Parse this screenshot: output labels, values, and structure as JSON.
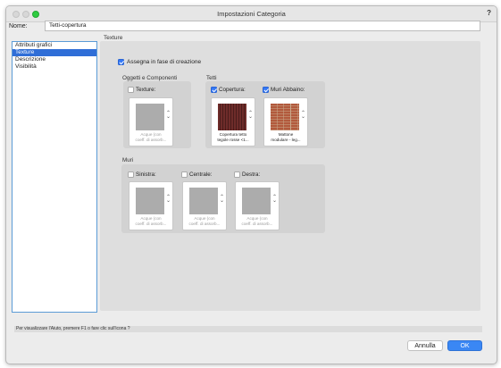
{
  "window": {
    "title": "Impostazioni Categoria",
    "help_label": "?"
  },
  "name_field": {
    "label": "Nome:",
    "value": "Tetti-copertura"
  },
  "categories": [
    {
      "label": "Attributi grafici",
      "selected": false
    },
    {
      "label": "Texture",
      "selected": true
    },
    {
      "label": "Descrizione",
      "selected": false
    },
    {
      "label": "Visibilità",
      "selected": false
    }
  ],
  "texture_panel": {
    "heading": "Texture",
    "assign_label": "Assegna in fase di creazione",
    "assign_checked": true,
    "group_objects": {
      "title": "Oggetti e Componenti",
      "slot": {
        "label": "Texture:",
        "checked": false,
        "caption1": "Acque (con",
        "caption2": "coeff. di assorb..."
      }
    },
    "group_roofs": {
      "title": "Tetti",
      "slots": [
        {
          "label": "Copertura:",
          "checked": true,
          "caption1": "Copertura tetto",
          "caption2": "tegole rosse <1...",
          "swatch": "roof-tiles"
        },
        {
          "label": "Muri Abbaino:",
          "checked": true,
          "caption1": "Mattone",
          "caption2": "modulare - leg...",
          "swatch": "brick"
        }
      ]
    },
    "group_walls": {
      "title": "Muri",
      "slots": [
        {
          "label": "Sinistra:",
          "checked": false,
          "caption1": "Acque (con",
          "caption2": "coeff. di assorb..."
        },
        {
          "label": "Centrale:",
          "checked": false,
          "caption1": "Acque (con",
          "caption2": "coeff. di assorb..."
        },
        {
          "label": "Destra:",
          "checked": false,
          "caption1": "Acque (con",
          "caption2": "coeff. di assorb..."
        }
      ]
    }
  },
  "status_bar": {
    "text": "Per visualizzare l'Aiuto, premere F1 o fare clic sull'icona ?"
  },
  "buttons": {
    "cancel": "Annulla",
    "ok": "OK"
  },
  "colors": {
    "selection": "#2f6ed7",
    "accent": "#3a87f4",
    "checkbox_on": "#3478f6"
  }
}
